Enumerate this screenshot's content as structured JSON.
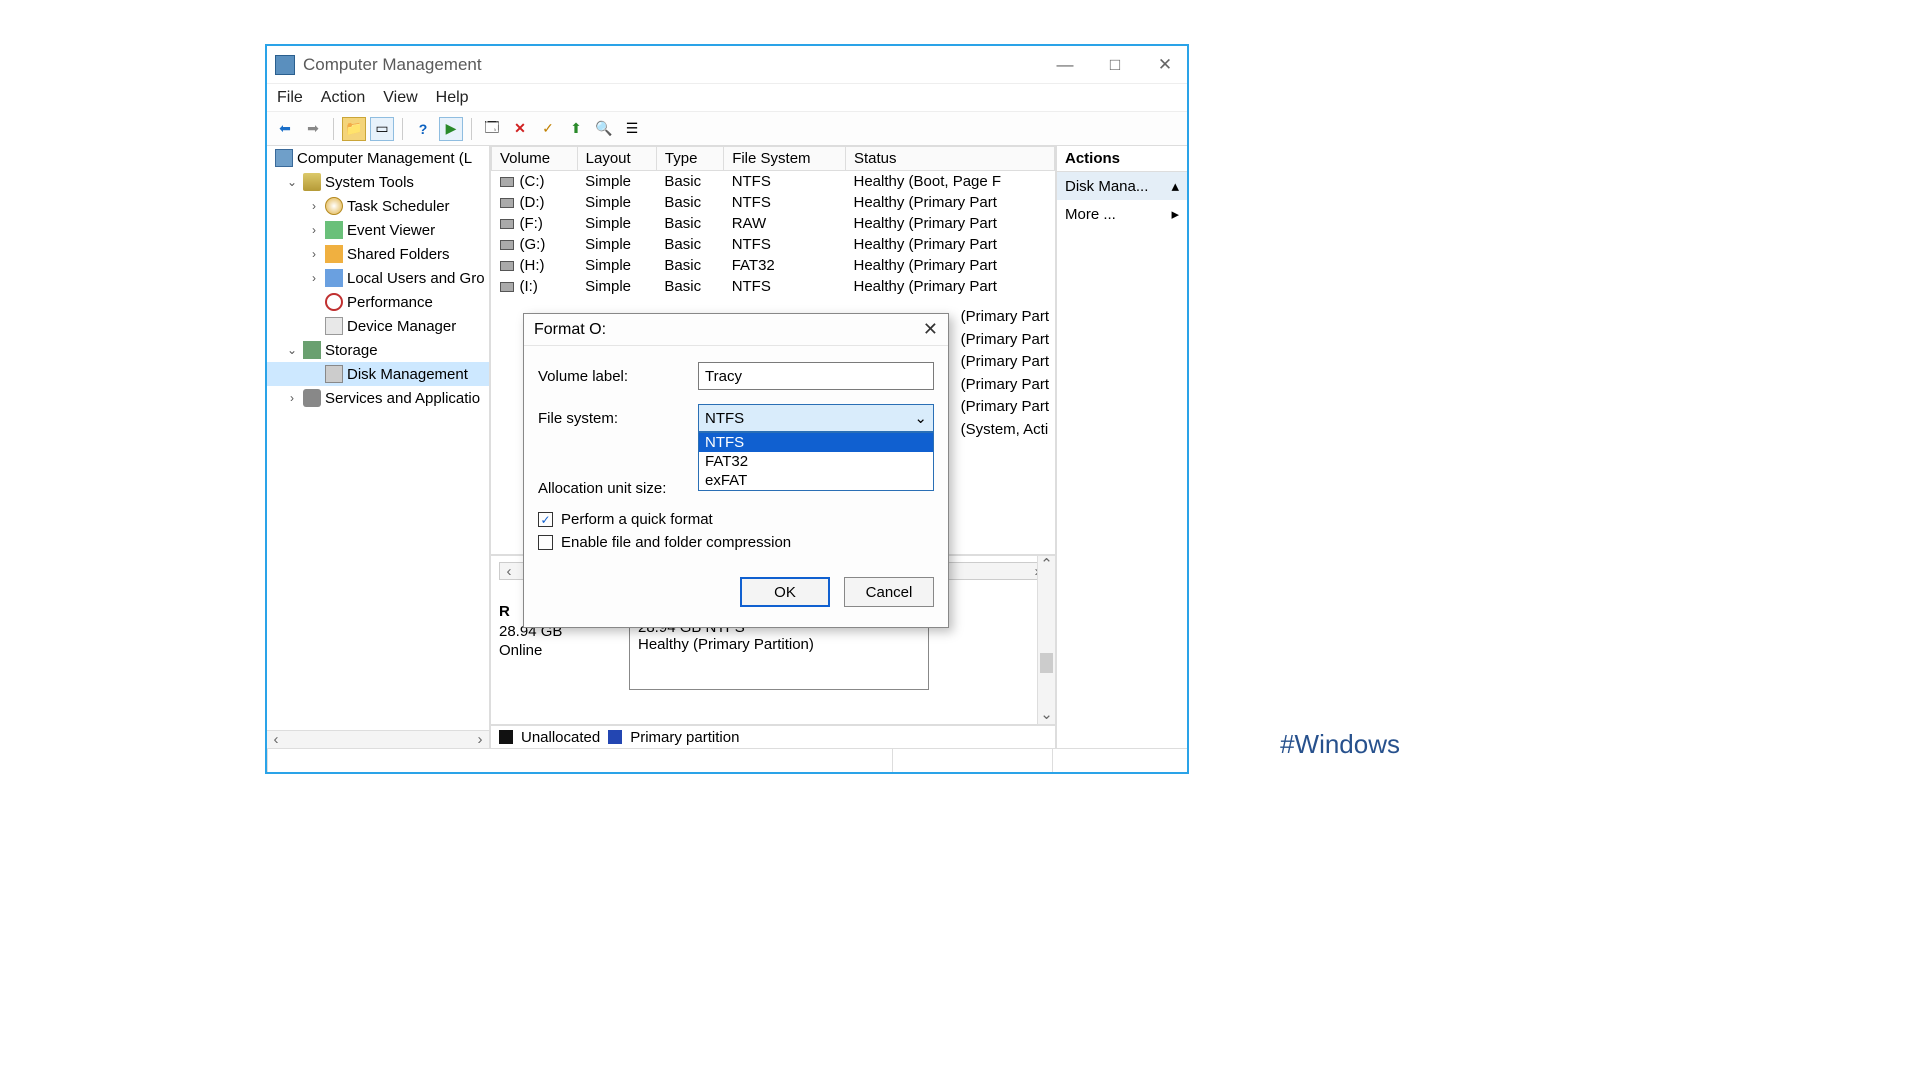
{
  "window": {
    "title": "Computer Management",
    "minimize": "—",
    "maximize": "□",
    "close": "✕"
  },
  "menu": {
    "file": "File",
    "action": "Action",
    "view": "View",
    "help": "Help"
  },
  "tree": {
    "root": "Computer Management (L",
    "system_tools": "System Tools",
    "task_scheduler": "Task Scheduler",
    "event_viewer": "Event Viewer",
    "shared_folders": "Shared Folders",
    "local_users": "Local Users and Gro",
    "performance": "Performance",
    "device_manager": "Device Manager",
    "storage": "Storage",
    "disk_management": "Disk Management",
    "services": "Services and Applicatio"
  },
  "columns": {
    "volume": "Volume",
    "layout": "Layout",
    "type": "Type",
    "fs": "File System",
    "status": "Status"
  },
  "volumes": [
    {
      "name": "(C:)",
      "layout": "Simple",
      "type": "Basic",
      "fs": "NTFS",
      "status": "Healthy (Boot, Page F"
    },
    {
      "name": "(D:)",
      "layout": "Simple",
      "type": "Basic",
      "fs": "NTFS",
      "status": "Healthy (Primary Part"
    },
    {
      "name": "(F:)",
      "layout": "Simple",
      "type": "Basic",
      "fs": "RAW",
      "status": "Healthy (Primary Part"
    },
    {
      "name": "(G:)",
      "layout": "Simple",
      "type": "Basic",
      "fs": "NTFS",
      "status": "Healthy (Primary Part"
    },
    {
      "name": "(H:)",
      "layout": "Simple",
      "type": "Basic",
      "fs": "FAT32",
      "status": "Healthy (Primary Part"
    },
    {
      "name": "(I:)",
      "layout": "Simple",
      "type": "Basic",
      "fs": "NTFS",
      "status": "Healthy (Primary Part"
    }
  ],
  "status_peek": [
    "(Primary Part",
    "(Primary Part",
    "(Primary Part",
    "(Primary Part",
    "(Primary Part",
    "(System, Acti"
  ],
  "diskinfo": {
    "label": "R",
    "size": "28.94 GB",
    "state": "Online"
  },
  "partinfo": {
    "line1": "28.94 GB NTFS",
    "line2": "Healthy (Primary Partition)"
  },
  "legend": {
    "unallocated": "Unallocated",
    "primary": "Primary partition"
  },
  "actions": {
    "header": "Actions",
    "disk_mana": "Disk Mana...",
    "more": "More ..."
  },
  "dialog": {
    "title": "Format O:",
    "close": "✕",
    "volume_label_lbl": "Volume label:",
    "volume_label_val": "Tracy",
    "filesystem_lbl": "File system:",
    "filesystem_val": "NTFS",
    "fs_options": [
      "NTFS",
      "FAT32",
      "exFAT"
    ],
    "alloc_lbl": "Allocation unit size:",
    "quickformat": "Perform a quick format",
    "compression": "Enable file and folder compression",
    "ok": "OK",
    "cancel": "Cancel"
  },
  "hashtag": "#Windows"
}
